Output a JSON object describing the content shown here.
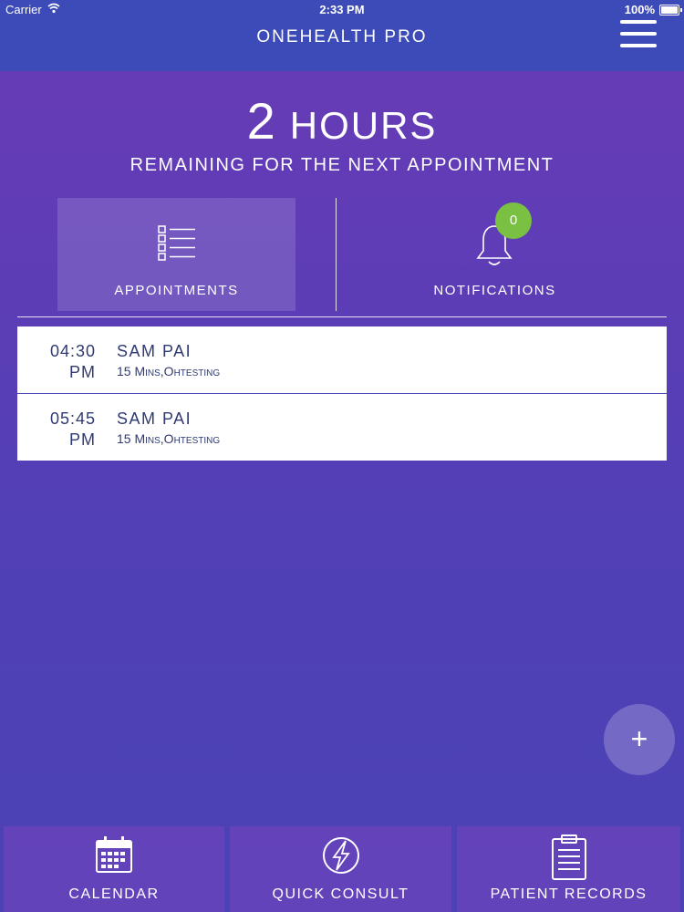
{
  "status_bar": {
    "carrier": "Carrier",
    "time": "2:33 PM",
    "battery": "100%"
  },
  "nav": {
    "title": "ONEHEALTH PRO",
    "menu_icon": "hamburger-menu-icon"
  },
  "hero": {
    "number": "2",
    "unit": "HOURS",
    "subtitle": "REMAINING FOR THE NEXT APPOINTMENT"
  },
  "tabs": [
    {
      "label": "APPOINTMENTS",
      "icon": "checklist-icon",
      "selected": true
    },
    {
      "label": "NOTIFICATIONS",
      "icon": "bell-icon",
      "badge": "0"
    }
  ],
  "appointments": [
    {
      "time": "04:30",
      "meridiem": "PM",
      "name": "SAM PAI",
      "detail": "15 Mins,Ohtesting"
    },
    {
      "time": "05:45",
      "meridiem": "PM",
      "name": "SAM PAI",
      "detail": "15 Mins,Ohtesting"
    }
  ],
  "fab": {
    "label": "+"
  },
  "bottom_nav": [
    {
      "label": "CALENDAR",
      "icon": "calendar-icon"
    },
    {
      "label": "QUICK CONSULT",
      "icon": "lightning-bolt-icon"
    },
    {
      "label": "PATIENT RECORDS",
      "icon": "clipboard-icon"
    }
  ],
  "colors": {
    "header": "#3c4bb8",
    "background_top": "#6a3bb6",
    "background_bottom": "#4a42b5",
    "badge": "#7ac143",
    "row_text": "#2f3a73"
  }
}
